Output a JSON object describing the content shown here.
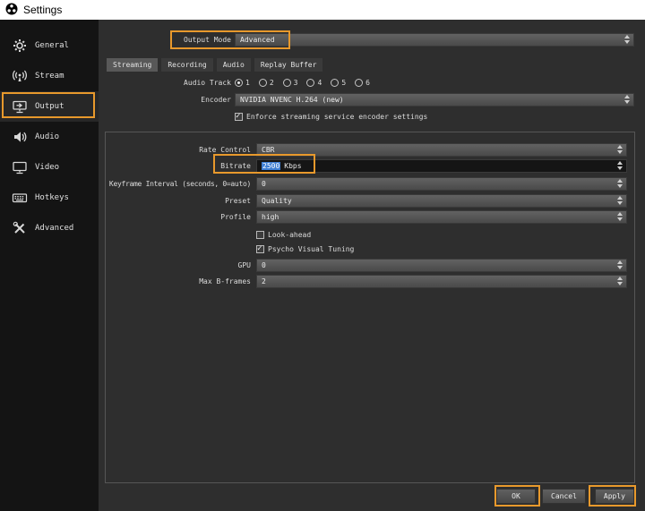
{
  "window": {
    "title": "Settings"
  },
  "sidebar": {
    "items": [
      {
        "label": "General",
        "icon": "gear-icon",
        "selected": false
      },
      {
        "label": "Stream",
        "icon": "antenna-icon",
        "selected": false
      },
      {
        "label": "Output",
        "icon": "output-icon",
        "selected": true
      },
      {
        "label": "Audio",
        "icon": "speaker-icon",
        "selected": false
      },
      {
        "label": "Video",
        "icon": "monitor-icon",
        "selected": false
      },
      {
        "label": "Hotkeys",
        "icon": "keyboard-icon",
        "selected": false
      },
      {
        "label": "Advanced",
        "icon": "tools-icon",
        "selected": false
      }
    ]
  },
  "output_mode": {
    "label": "Output Mode",
    "value": "Advanced"
  },
  "tabs": [
    {
      "label": "Streaming",
      "selected": true
    },
    {
      "label": "Recording",
      "selected": false
    },
    {
      "label": "Audio",
      "selected": false
    },
    {
      "label": "Replay Buffer",
      "selected": false
    }
  ],
  "streaming": {
    "audio_track": {
      "label": "Audio Track",
      "options": [
        "1",
        "2",
        "3",
        "4",
        "5",
        "6"
      ],
      "selected": "1"
    },
    "encoder": {
      "label": "Encoder",
      "value": "NVIDIA NVENC H.264 (new)"
    },
    "enforce_settings": {
      "label": "Enforce streaming service encoder settings",
      "checked": true
    },
    "rate_control": {
      "label": "Rate Control",
      "value": "CBR"
    },
    "bitrate": {
      "label": "Bitrate",
      "value": "2500",
      "suffix": "Kbps",
      "value_selected": true
    },
    "keyframe_interval": {
      "label": "Keyframe Interval (seconds, 0=auto)",
      "value": "0"
    },
    "preset": {
      "label": "Preset",
      "value": "Quality"
    },
    "profile": {
      "label": "Profile",
      "value": "high"
    },
    "look_ahead": {
      "label": "Look-ahead",
      "checked": false
    },
    "psycho_visual_tuning": {
      "label": "Psycho Visual Tuning",
      "checked": true
    },
    "gpu": {
      "label": "GPU",
      "value": "0"
    },
    "max_b_frames": {
      "label": "Max B-frames",
      "value": "2"
    }
  },
  "footer": {
    "ok_label": "OK",
    "cancel_label": "Cancel",
    "apply_label": "Apply"
  },
  "colors": {
    "annotation_orange": "#e8992c",
    "selection_blue": "#3f7fd4",
    "sidebar_bg": "#141414",
    "content_bg": "#2e2e2e",
    "titlebar_bg": "#ffffff"
  }
}
